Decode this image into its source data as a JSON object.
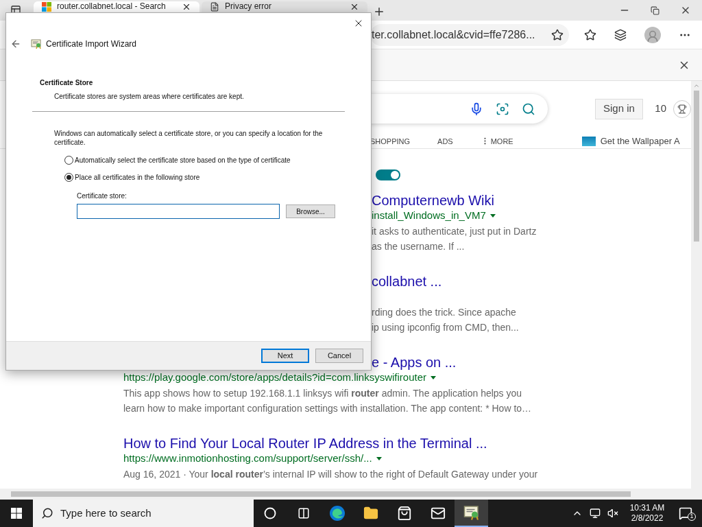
{
  "browser": {
    "tabs": [
      {
        "title": "router.collabnet.local - Search",
        "selected": true
      },
      {
        "title": "Privacy error",
        "selected": false
      }
    ],
    "address": "ter.collabnet.local&cvid=ffe7286..."
  },
  "page": {
    "sign_in": "Sign in",
    "rewards": "10",
    "nav": [
      {
        "label": "SHOPPING",
        "kind": "plain"
      },
      {
        "label": "ADS",
        "kind": "plain"
      },
      {
        "label": "MORE",
        "kind": "menu"
      }
    ],
    "promo": "Get the Wallpaper A",
    "toggle": {
      "on": true
    },
    "results": [
      {
        "kind": "partial",
        "title": "Computernewb Wiki",
        "url": "install_Windows_in_VM7",
        "snippet_lines": [
          "it asks to authenticate, just put in Dartz",
          "as the username. If ..."
        ]
      },
      {
        "kind": "partial",
        "title": "collabnet ...",
        "snippet_lines": [
          "rding does the trick. Since apache",
          "ip using ipconfig from CMD, then..."
        ]
      },
      {
        "kind": "partial_title",
        "title": "e - Apps on ...",
        "url": "https://play.google.com/store/apps/details?id=com.linksyswifirouter",
        "snippet_lines": [
          "This app shows how to setup 192.168.1.1 linksys wifi **router** admin. The application helps you",
          "learn how to make important configuration settings with installation. The app content: * How to…"
        ]
      },
      {
        "kind": "full",
        "title": "How to Find Your Local Router IP Address in the Terminal ...",
        "url": "https://www.inmotionhosting.com/support/server/ssh/...",
        "snippet_lines": [
          "Aug 16, 2021 · Your **local router**’s internal IP will show to the right of Default Gateway under your"
        ]
      }
    ]
  },
  "dialog": {
    "title": "Certificate Import Wizard",
    "heading": "Certificate Store",
    "subheading": "Certificate stores are system areas where certificates are kept.",
    "intro": "Windows can automatically select a certificate store, or you can specify a location for the certificate.",
    "options": [
      {
        "label": "Automatically select the certificate store based on the type of certificate",
        "selected": false
      },
      {
        "label": "Place all certificates in the following store",
        "selected": true
      }
    ],
    "store_label": "Certificate store:",
    "store_field": {
      "focused": true
    },
    "browse": "Browse...",
    "buttons": [
      {
        "label": "Next",
        "default": true
      },
      {
        "label": "Cancel",
        "default": false
      }
    ]
  },
  "taskbar": {
    "search_placeholder": "Type here to search",
    "apps": [
      {
        "kind": "cortana",
        "active": false
      },
      {
        "kind": "taskview",
        "active": false
      },
      {
        "kind": "edge",
        "active": false
      },
      {
        "kind": "explorer",
        "active": false
      },
      {
        "kind": "store",
        "active": false
      },
      {
        "kind": "mail",
        "active": false
      },
      {
        "kind": "certificate",
        "active": true
      }
    ],
    "time": "10:31 AM",
    "date": "2/8/2022",
    "notifications": "1"
  }
}
